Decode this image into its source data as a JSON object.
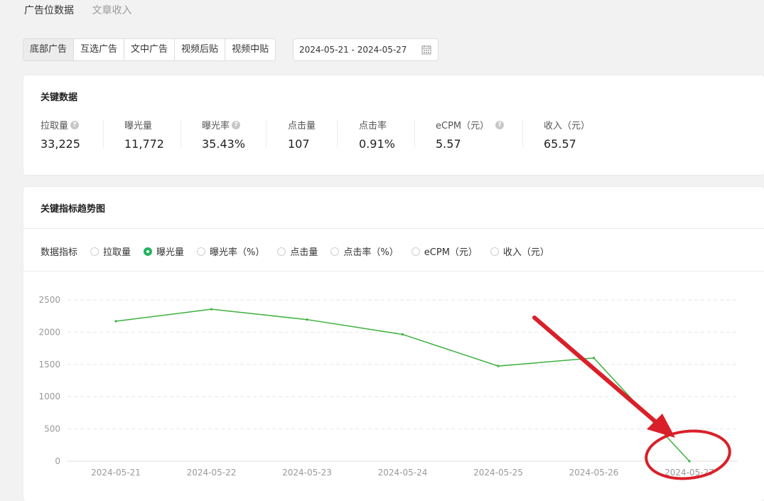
{
  "top_tabs": [
    {
      "label": "广告位数据",
      "active": true
    },
    {
      "label": "文章收入",
      "active": false
    }
  ],
  "ad_types": [
    "底部广告",
    "互选广告",
    "文中广告",
    "视频后贴",
    "视频中贴"
  ],
  "ad_type_selected": "底部广告",
  "date_range": "2024-05-21 - 2024-05-27",
  "key_data": {
    "title": "关键数据",
    "metrics": [
      {
        "label": "拉取量",
        "value": "33,225",
        "help": true
      },
      {
        "label": "曝光量",
        "value": "11,772",
        "help": false
      },
      {
        "label": "曝光率",
        "value": "35.43%",
        "help": true
      },
      {
        "label": "点击量",
        "value": "107",
        "help": false
      },
      {
        "label": "点击率",
        "value": "0.91%",
        "help": false
      },
      {
        "label": "eCPM（元）",
        "value": "5.57",
        "help": true
      },
      {
        "label": "收入（元）",
        "value": "65.57",
        "help": false
      }
    ]
  },
  "trend": {
    "title": "关键指标趋势图",
    "metric_label": "数据指标",
    "options": [
      "拉取量",
      "曝光量",
      "曝光率（%）",
      "点击量",
      "点击率（%）",
      "eCPM（元）",
      "收入（元）"
    ],
    "selected": "曝光量"
  },
  "chart_data": {
    "type": "line",
    "x": [
      "2024-05-21",
      "2024-05-22",
      "2024-05-23",
      "2024-05-24",
      "2024-05-25",
      "2024-05-26",
      "2024-05-27"
    ],
    "series": [
      {
        "values": [
          2170,
          2355,
          2195,
          1965,
          1475,
          1600,
          0
        ],
        "color": "#3cb13c"
      }
    ],
    "ylim": [
      0,
      2500
    ],
    "yticks": [
      0,
      500,
      1000,
      1500,
      2000,
      2500
    ],
    "grid": true
  },
  "annotation": {
    "color": "#d9202a"
  }
}
